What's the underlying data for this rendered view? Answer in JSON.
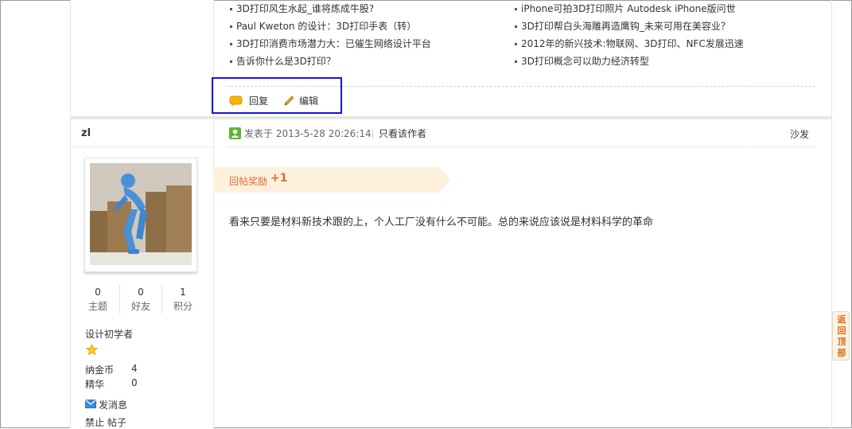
{
  "related": {
    "left": [
      "3D打印风生水起_谁将炼成牛股?",
      "Paul Kweton 的设计：3D打印手表（转）",
      "3D打印消费市场潜力大：已催生网络设计平台",
      "告诉你什么是3D打印？"
    ],
    "right": [
      "iPhone可拍3D打印照片 Autodesk iPhone版问世",
      "3D打印帮白头海雕再造鹰钩_未来可用在美容业？",
      "2012年的新兴技术:物联网、3D打印、NFC发展迅速",
      "3D打印概念可以助力经济转型"
    ]
  },
  "actions": {
    "reply": "回复",
    "edit": "编辑"
  },
  "post": {
    "author": "zl",
    "posted_at": "发表于 2013-5-28 20:26:14",
    "only_author": "只看该作者",
    "floor": "沙发",
    "reward_label": "回帖奖励",
    "reward_value": "+1",
    "content": "看来只要是材料新技术跟的上，个人工厂没有什么不可能。总的来说应该说是材料科学的革命"
  },
  "user": {
    "stats": [
      {
        "value": "0",
        "label": "主题"
      },
      {
        "value": "0",
        "label": "好友"
      },
      {
        "value": "1",
        "label": "积分"
      }
    ],
    "level": "设计初学者",
    "coins_label": "纳金币",
    "coins_value": "4",
    "essence_label": "精华",
    "essence_value": "0",
    "send_message": "发消息",
    "ban": "禁止 帖子"
  },
  "back_to_top": [
    "返",
    "回",
    "顶",
    "部"
  ],
  "colors": {
    "accent": "#e06a34",
    "highlight_box": "#1414dc",
    "user_icon": "#5cb531"
  }
}
